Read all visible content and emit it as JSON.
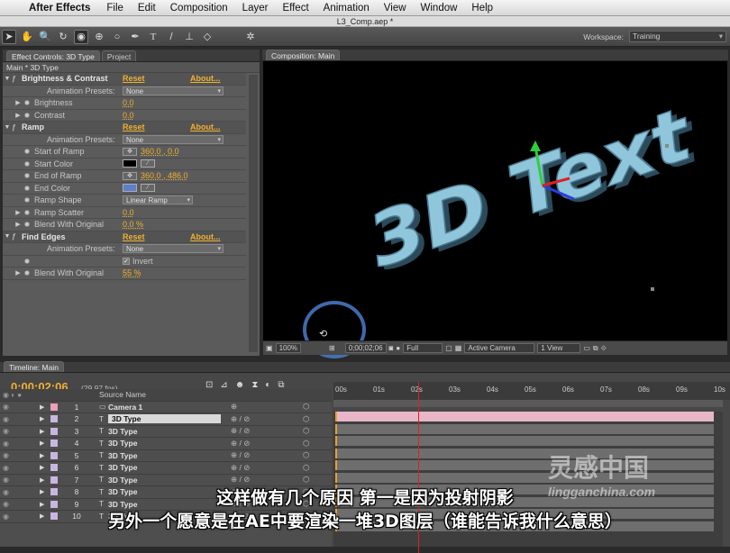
{
  "menubar": {
    "app": "After Effects",
    "items": [
      "File",
      "Edit",
      "Composition",
      "Layer",
      "Effect",
      "Animation",
      "View",
      "Window",
      "Help"
    ]
  },
  "window_title": "L3_Comp.aep *",
  "workspace": {
    "label": "Workspace:",
    "value": "Training"
  },
  "effect_controls": {
    "tabs": [
      "Effect Controls: 3D Type",
      "Project"
    ],
    "header": "Main * 3D Type",
    "effects": [
      {
        "name": "Brightness & Contrast",
        "reset": "Reset",
        "about": "About...",
        "presets_label": "Animation Presets:",
        "presets_value": "None",
        "params": [
          {
            "label": "Brightness",
            "value": "0.0"
          },
          {
            "label": "Contrast",
            "value": "0.0"
          }
        ]
      },
      {
        "name": "Ramp",
        "reset": "Reset",
        "about": "About...",
        "presets_label": "Animation Presets:",
        "presets_value": "None",
        "params": [
          {
            "label": "Start of Ramp",
            "value": "360.0 , 0.0"
          },
          {
            "label": "Start Color",
            "value": ""
          },
          {
            "label": "End of Ramp",
            "value": "360.0 , 486.0"
          },
          {
            "label": "End Color",
            "value": ""
          },
          {
            "label": "Ramp Shape",
            "value": "Linear Ramp"
          },
          {
            "label": "Ramp Scatter",
            "value": "0.0"
          },
          {
            "label": "Blend With Original",
            "value": "0.0 %"
          }
        ]
      },
      {
        "name": "Find Edges",
        "reset": "Reset",
        "about": "About...",
        "presets_label": "Animation Presets:",
        "presets_value": "None",
        "params": [
          {
            "label": "Invert",
            "value": "Invert"
          },
          {
            "label": "Blend With Original",
            "value": "55 %"
          }
        ]
      }
    ]
  },
  "composition": {
    "tab": "Composition: Main",
    "text3d": "3D Text",
    "zoom": "100%",
    "timecode": "0;00;02;06",
    "resolution": "Full",
    "camera": "Active Camera",
    "views": "1 View"
  },
  "timeline": {
    "tab": "Timeline: Main",
    "timecode": "0;00;02;06",
    "fps": "(29.97 fps)",
    "source_header": "Source Name",
    "ruler": [
      "00s",
      "01s",
      "02s",
      "03s",
      "04s",
      "05s",
      "06s",
      "07s",
      "08s",
      "09s",
      "10s"
    ],
    "layers": [
      {
        "num": "1",
        "name": "Camera 1"
      },
      {
        "num": "2",
        "name": "3D Type"
      },
      {
        "num": "3",
        "name": "3D Type"
      },
      {
        "num": "4",
        "name": "3D Type"
      },
      {
        "num": "5",
        "name": "3D Type"
      },
      {
        "num": "6",
        "name": "3D Type"
      },
      {
        "num": "7",
        "name": "3D Type"
      },
      {
        "num": "8",
        "name": "3D Type"
      },
      {
        "num": "9",
        "name": "3D Type"
      },
      {
        "num": "10",
        "name": "3D Type"
      }
    ]
  },
  "subtitles": [
    "这样做有几个原因  第一是因为投射阴影",
    "另外一个愿意是在AE中要渲染一堆3D图层（谁能告诉我什么意思）"
  ],
  "watermark": {
    "cn": "灵感中国",
    "url": "lingganchina.com"
  }
}
